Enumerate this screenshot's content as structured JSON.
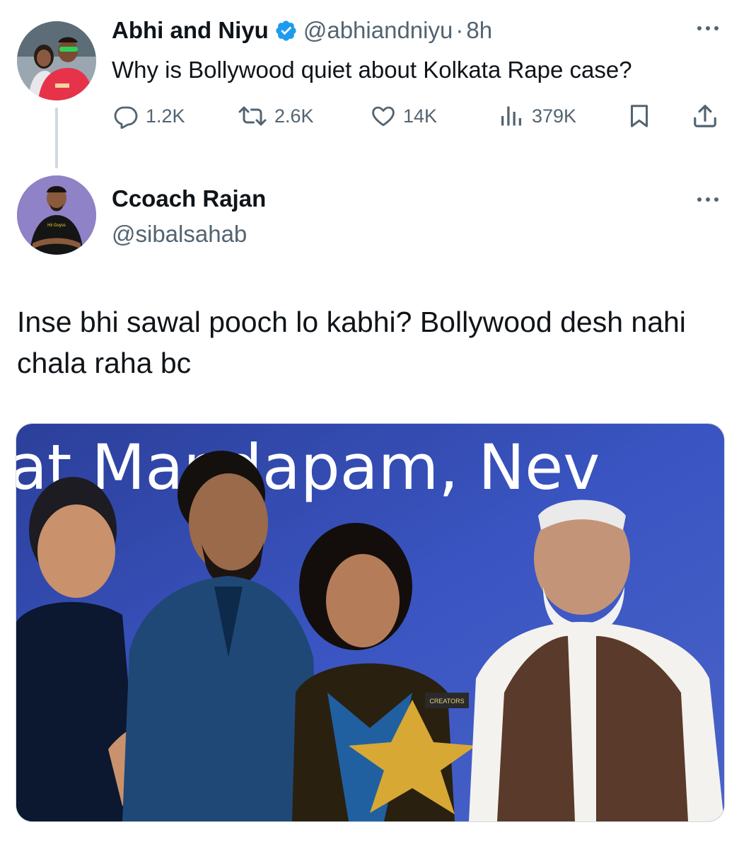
{
  "original_tweet": {
    "display_name": "Abhi and Niyu",
    "handle": "@abhiandniyu",
    "separator": "·",
    "time": "8h",
    "verified": true,
    "more_icon": "more-horizontal-icon",
    "text": "Why is Bollywood quiet about Kolkata Rape case?",
    "stats": {
      "replies": "1.2K",
      "retweets": "2.6K",
      "likes": "14K",
      "views": "379K"
    },
    "icons": {
      "reply": "reply-icon",
      "retweet": "retweet-icon",
      "like": "heart-icon",
      "views": "views-chart-icon",
      "bookmark": "bookmark-icon",
      "share": "share-icon"
    }
  },
  "reply_tweet": {
    "display_name": "Ccoach Rajan",
    "handle": "@sibalsahab",
    "more_icon": "more-horizontal-icon",
    "text": "Inse bhi sawal pooch lo kabhi? Bollywood desh nahi chala raha bc",
    "image": {
      "banner_text": "at Mandapam, Nev",
      "trophy_label": "CREATORS"
    }
  },
  "colors": {
    "text_primary": "#0f1419",
    "text_secondary": "#536471",
    "verified_blue": "#1d9bf0",
    "thread_line": "#cfd9de"
  }
}
